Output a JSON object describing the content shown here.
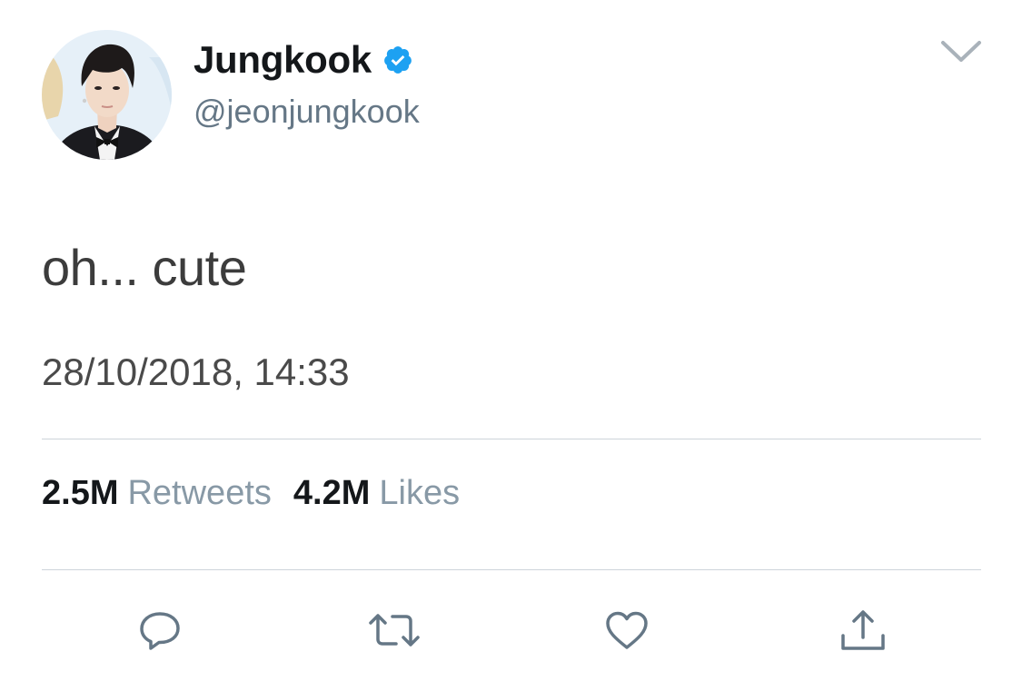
{
  "author": {
    "display_name": "Jungkook",
    "handle": "@jeonjungkook",
    "verified": true,
    "avatar_icon": "profile-photo"
  },
  "tweet": {
    "text": "oh... cute",
    "timestamp": "28/10/2018, 14:33"
  },
  "stats": {
    "retweets_count": "2.5M",
    "retweets_label": "Retweets",
    "likes_count": "4.2M",
    "likes_label": "Likes"
  },
  "actions": {
    "reply_icon": "reply-icon",
    "retweet_icon": "retweet-icon",
    "like_icon": "heart-icon",
    "share_icon": "share-icon"
  },
  "colors": {
    "verified_blue": "#1da1f2",
    "icon_gray": "#657786",
    "label_gray": "#8899a6",
    "divider": "#cdd4da"
  }
}
